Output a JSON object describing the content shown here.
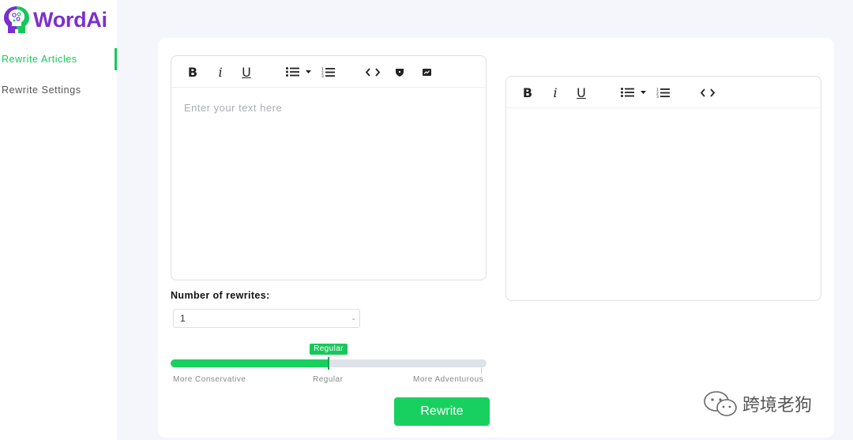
{
  "app": {
    "name": "WordAi",
    "brand_purple": "#7b2fd0",
    "accent_green": "#18c75a"
  },
  "sidebar": {
    "items": [
      {
        "label": "Rewrite Articles",
        "active": true
      },
      {
        "label": "Rewrite Settings",
        "active": false
      }
    ]
  },
  "input_editor": {
    "placeholder": "Enter your text here",
    "toolbar": [
      "bold-icon",
      "italic-icon",
      "underline-icon",
      "bullet-list-icon",
      "dropdown-caret-icon",
      "numbered-list-icon",
      "code-icon",
      "shield-icon",
      "image-icon"
    ],
    "bold_label": "B",
    "italic_label": "i",
    "underline_label": "U"
  },
  "output_editor": {
    "toolbar": [
      "bold-icon",
      "italic-icon",
      "underline-icon",
      "bullet-list-icon",
      "dropdown-caret-icon",
      "numbered-list-icon",
      "code-icon"
    ],
    "bold_label": "B",
    "italic_label": "i",
    "underline_label": "U"
  },
  "rewrites": {
    "label": "Number of rewrites:",
    "selected": "1"
  },
  "creativity": {
    "value_fraction": 0.5,
    "current_label": "Regular",
    "labels": {
      "left": "More Conservative",
      "middle": "Regular",
      "right": "More Adventurous"
    }
  },
  "rewrite_button": {
    "label": "Rewrite"
  },
  "watermark": {
    "text": "跨境老狗"
  }
}
